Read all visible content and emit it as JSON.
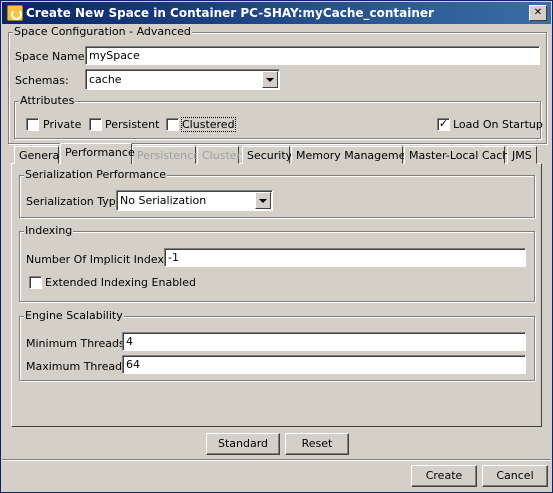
{
  "window": {
    "title": "Create New Space in Container PC-SHAY:myCache_container",
    "close_glyph": "✕"
  },
  "config_group": {
    "legend": "Space Configuration - Advanced",
    "space_name_label": "Space Name:",
    "space_name_value": "mySpace",
    "schemas_label": "Schemas:",
    "schemas_value": "cache"
  },
  "attributes": {
    "legend": "Attributes",
    "private_label": "Private",
    "private_checked": false,
    "persistent_label": "Persistent",
    "persistent_checked": false,
    "clustered_label": "Clustered",
    "clustered_checked": false,
    "load_on_startup_label": "Load On Startup",
    "load_on_startup_checked": true,
    "check_glyph": "✓"
  },
  "tabs": [
    {
      "label": "General",
      "enabled": true,
      "selected": false
    },
    {
      "label": "Performance",
      "enabled": true,
      "selected": true
    },
    {
      "label": "Persistence",
      "enabled": false,
      "selected": false
    },
    {
      "label": "Cluster",
      "enabled": false,
      "selected": false
    },
    {
      "label": "Security",
      "enabled": true,
      "selected": false
    },
    {
      "label": "Memory Management",
      "enabled": true,
      "selected": false
    },
    {
      "label": "Master-Local Cache",
      "enabled": true,
      "selected": false
    },
    {
      "label": "JMS",
      "enabled": true,
      "selected": false
    }
  ],
  "serialization": {
    "legend": "Serialization Performance",
    "type_label": "Serialization Type:",
    "type_value": "No Serialization"
  },
  "indexing": {
    "legend": "Indexing",
    "implicit_label": "Number Of Implicit Indexes:",
    "implicit_value": "-1",
    "extended_label": "Extended Indexing Enabled",
    "extended_checked": false
  },
  "scalability": {
    "legend": "Engine Scalability",
    "min_label": "Minimum Threads:",
    "min_value": "4",
    "max_label": "Maximum Threads:",
    "max_value": "64"
  },
  "buttons": {
    "standard": "Standard",
    "reset": "Reset",
    "create": "Create",
    "cancel": "Cancel"
  }
}
